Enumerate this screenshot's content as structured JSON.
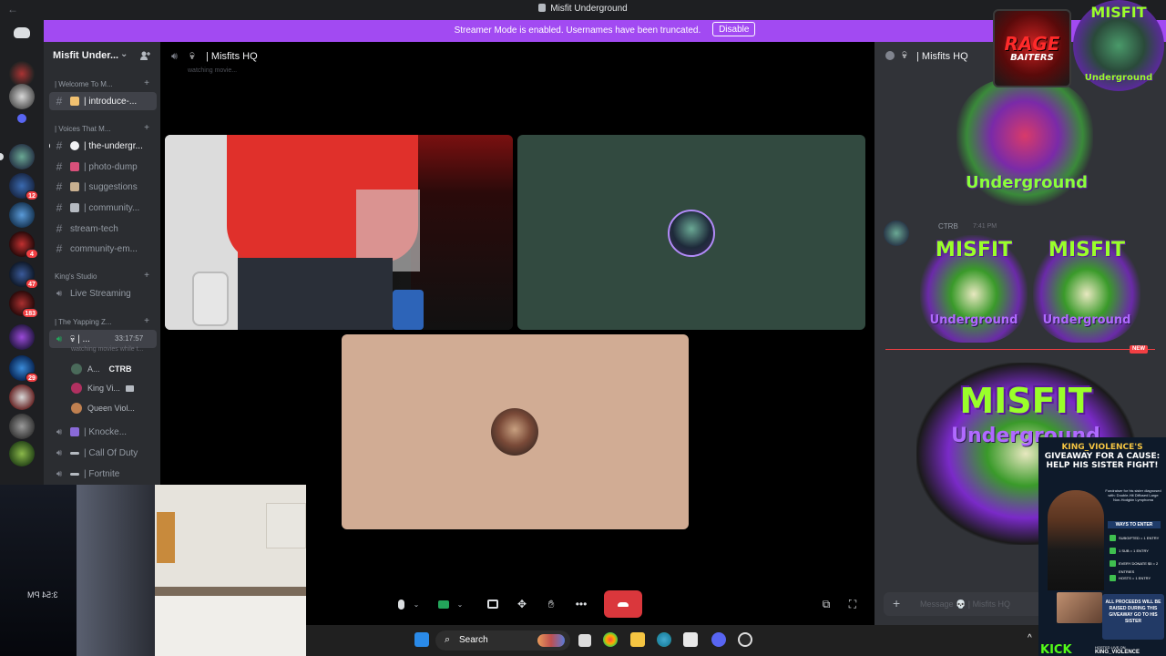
{
  "window": {
    "title": "Misfit Underground"
  },
  "banner": {
    "text": "Streamer Mode is enabled. Usernames have been truncated.",
    "disable_label": "Disable",
    "color": "#a24af2"
  },
  "server": {
    "name": "Misfit Under...",
    "chevron": "⌄"
  },
  "rail": {
    "badges": [
      "12",
      "4",
      "47",
      "183",
      "29"
    ]
  },
  "sidebar": {
    "categories": {
      "welcome": "| Welcome To M...",
      "voices": "| Voices That M...",
      "kings_studio": "King's Studio",
      "yapping": "| The Yapping Z..."
    },
    "channels": {
      "introduce": "| introduce-...",
      "underground": "| the-undergr...",
      "photo_dump": "| photo-dump",
      "suggestions": "| suggestions",
      "community": "| community...",
      "stream_tech": "stream-tech",
      "community_em": "community-em...",
      "live_streaming": "Live Streaming",
      "misfits_hq": "| ...",
      "knocke": "| Knocke...",
      "call_of_duty": "| Call Of Duty",
      "fortnite": "| Fortnite"
    },
    "voice_timer": "33:17:57",
    "voice_status": "watching movies while t...",
    "voice_users": {
      "u1": "A...",
      "u1_tag": "CTRB",
      "u2": "King Vi...",
      "u3": "Queen Viol..."
    }
  },
  "call": {
    "channel": "| Misfits HQ",
    "status": "watching movie..."
  },
  "chat": {
    "channel": "| Misfits HQ",
    "message_user": "CTRB",
    "message_time": "7:41 PM",
    "new_label": "NEW",
    "input_placeholder": "Message 💀 | Misfits HQ"
  },
  "stickers": {
    "word1": "MISFIT",
    "word2": "Underground",
    "rage1": "RAGE",
    "rage2": "BAITERS"
  },
  "overlay": {
    "clock": "3:54 PM"
  },
  "ad": {
    "headline_1": "KING_VIOLENCE'S",
    "headline_2": "GIVEAWAY FOR A CAUSE:",
    "headline_3": "HELP HIS SISTER FIGHT!",
    "sub": "Fundraiser for his sister diagnosed with: Double-Hit Diffused Large Non-Hodgkin Lymphoma",
    "ways": "WAYS TO ENTER",
    "rule1": "SUBGIFTED = 1 ENTRY",
    "rule2": "1 SUB = 1 ENTRY",
    "rule3": "EVERY DONATE $5 = 2 ENTRIES",
    "rule4": "HOSTS = 1 ENTRY",
    "panel": "ALL PROCEEDS WILL BE RAISED DURING THIS GIVEAWAY GO TO HIS SISTER",
    "kick": "KICK",
    "hosted_by": "HOSTED LIVE ON",
    "host_name": "KING_VIOLENCE"
  },
  "taskbar": {
    "search_label": "Search"
  }
}
